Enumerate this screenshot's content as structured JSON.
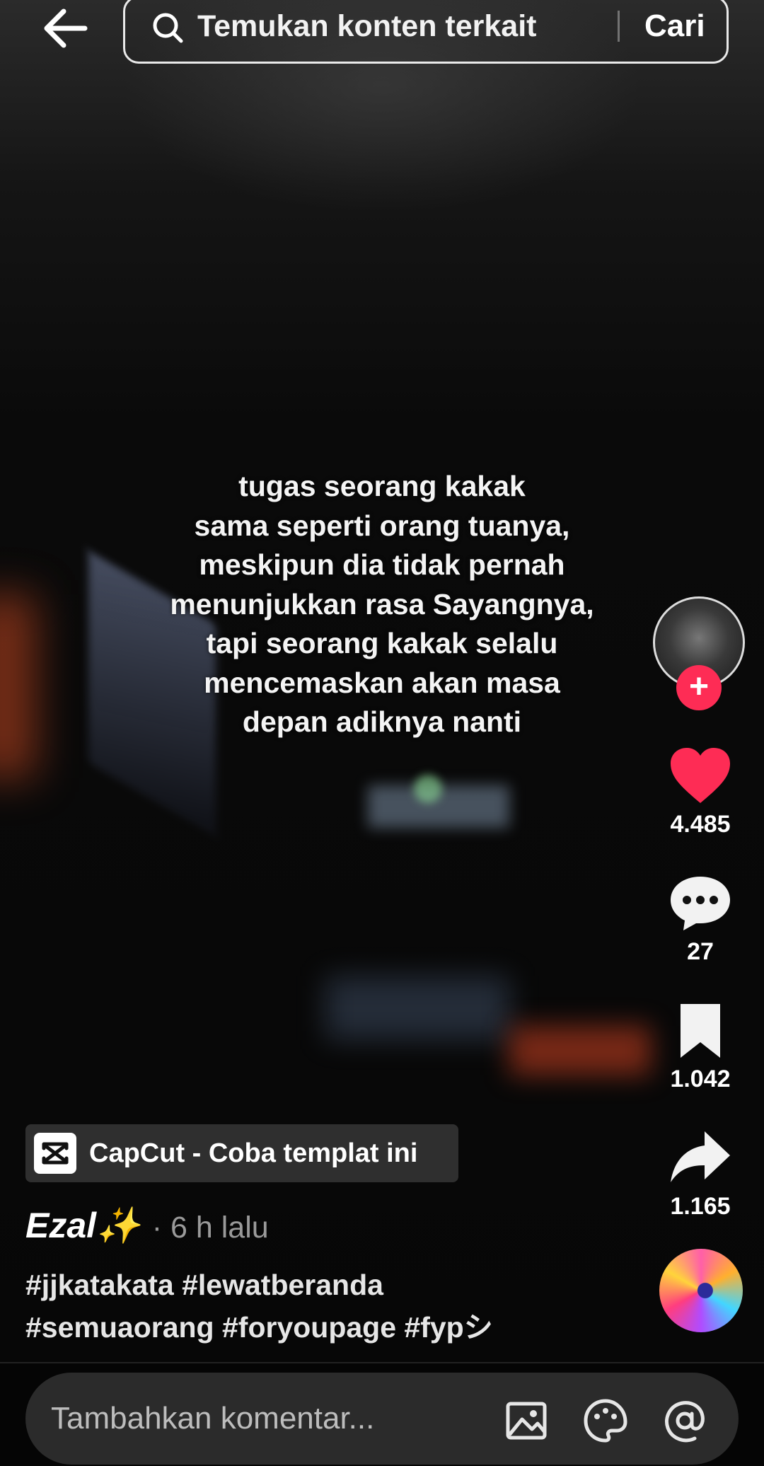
{
  "search": {
    "placeholder": "Temukan konten terkait",
    "submit_label": "Cari"
  },
  "video": {
    "caption_lines": [
      "tugas seorang kakak",
      "sama seperti orang tuanya,",
      "meskipun dia tidak pernah",
      "menunjukkan rasa Sayangnya,",
      "tapi seorang kakak selalu",
      "mencemaskan akan masa",
      "depan adiknya nanti"
    ]
  },
  "actions": {
    "likes": "4.485",
    "comments": "27",
    "saves": "1.042",
    "shares": "1.165"
  },
  "template": {
    "label": "CapCut - Coba templat ini"
  },
  "author": {
    "name": "Ezal✨",
    "time": "· 6 h lalu"
  },
  "description": {
    "line1": "#jjkatakata #lewatberanda",
    "line2": "#semuaorang #foryoupage #fypシ"
  },
  "comment": {
    "placeholder": "Tambahkan komentar..."
  },
  "colors": {
    "like": "#fe2c55",
    "follow": "#fe2c55",
    "background": "#050505"
  },
  "icons": {
    "back": "arrow-left-icon",
    "search": "search-icon",
    "like": "heart-icon",
    "comment": "comment-bubble-icon",
    "save": "bookmark-icon",
    "share": "share-arrow-icon",
    "image": "image-icon",
    "emoji": "emoji-icon",
    "mention": "at-mention-icon"
  }
}
